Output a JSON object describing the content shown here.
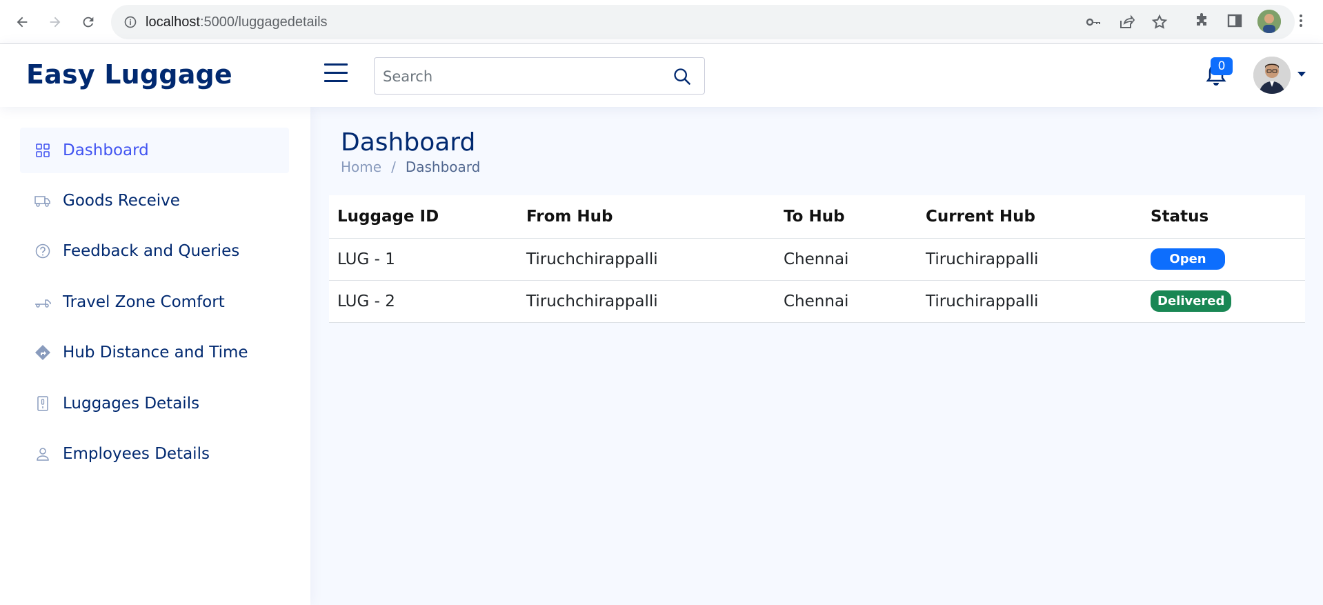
{
  "browser": {
    "url_host": "localhost",
    "url_path": ":5000/luggagedetails"
  },
  "header": {
    "logo": "Easy Luggage",
    "search": {
      "placeholder": "Search",
      "value": ""
    },
    "notifications_count": "0"
  },
  "sidebar": {
    "items": [
      {
        "label": "Dashboard",
        "icon": "grid-icon",
        "active": true
      },
      {
        "label": "Goods Receive",
        "icon": "truck-icon",
        "active": false
      },
      {
        "label": "Feedback and Queries",
        "icon": "question-circle-icon",
        "active": false
      },
      {
        "label": "Travel Zone Comfort",
        "icon": "truck-flatbed-icon",
        "active": false
      },
      {
        "label": "Hub Distance and Time",
        "icon": "sign-turn-right-icon",
        "active": false
      },
      {
        "label": "Luggages Details",
        "icon": "luggage-icon",
        "active": false
      },
      {
        "label": "Employees Details",
        "icon": "person-icon",
        "active": false
      }
    ]
  },
  "main": {
    "title": "Dashboard",
    "breadcrumb": {
      "home": "Home",
      "separator": "/",
      "current": "Dashboard"
    },
    "table": {
      "headers": [
        "Luggage ID",
        "From Hub",
        "To Hub",
        "Current Hub",
        "Status"
      ],
      "rows": [
        {
          "id": "LUG - 1",
          "from": "Tiruchchirappalli",
          "to": "Chennai",
          "current": "Tiruchirappalli",
          "status": "Open",
          "status_kind": "open"
        },
        {
          "id": "LUG - 2",
          "from": "Tiruchchirappalli",
          "to": "Chennai",
          "current": "Tiruchirappalli",
          "status": "Delivered",
          "status_kind": "delivered"
        }
      ]
    }
  },
  "colors": {
    "brand": "#012970",
    "active": "#4154f1",
    "open": "#0d6efd",
    "delivered": "#198754"
  }
}
